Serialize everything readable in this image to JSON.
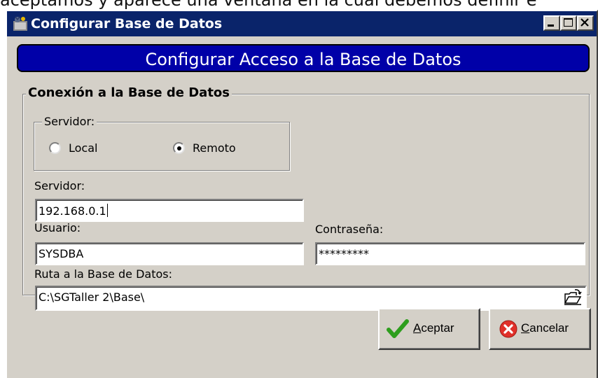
{
  "background_text": "aceptamos y aparece una ventana en la cual debemos definir e",
  "window": {
    "title": "Configurar Base de Datos",
    "controls": [
      "minimize-icon",
      "maximize-icon",
      "close-icon"
    ]
  },
  "banner": {
    "text": "Configurar Acceso a la Base de Datos"
  },
  "connection_group": {
    "title": "Conexión a la Base de Datos",
    "server_type_group": {
      "title": "Servidor:",
      "options": [
        {
          "label": "Local",
          "checked": false
        },
        {
          "label": "Remoto",
          "checked": true
        }
      ]
    },
    "server_label": "Servidor:",
    "server_value": "192.168.0.1",
    "user_label": "Usuario:",
    "user_value": "SYSDBA",
    "password_label": "Contraseña:",
    "password_value": "*********",
    "db_path_label": "Ruta a la Base de Datos:",
    "db_path_value": "C:\\SGTaller 2\\Base\\",
    "browse_icon": "open-folder-icon"
  },
  "buttons": {
    "accept": {
      "mnemonic": "A",
      "rest": "ceptar",
      "icon": "checkmark-icon",
      "icon_color": "#2e9e1e"
    },
    "cancel": {
      "mnemonic": "C",
      "rest": "ancelar",
      "icon": "cancel-x-icon",
      "icon_color": "#e0302a"
    }
  },
  "colors": {
    "titlebar": "#0a246a",
    "banner": "#0000a8",
    "dialog_face": "#d4d0c8"
  }
}
